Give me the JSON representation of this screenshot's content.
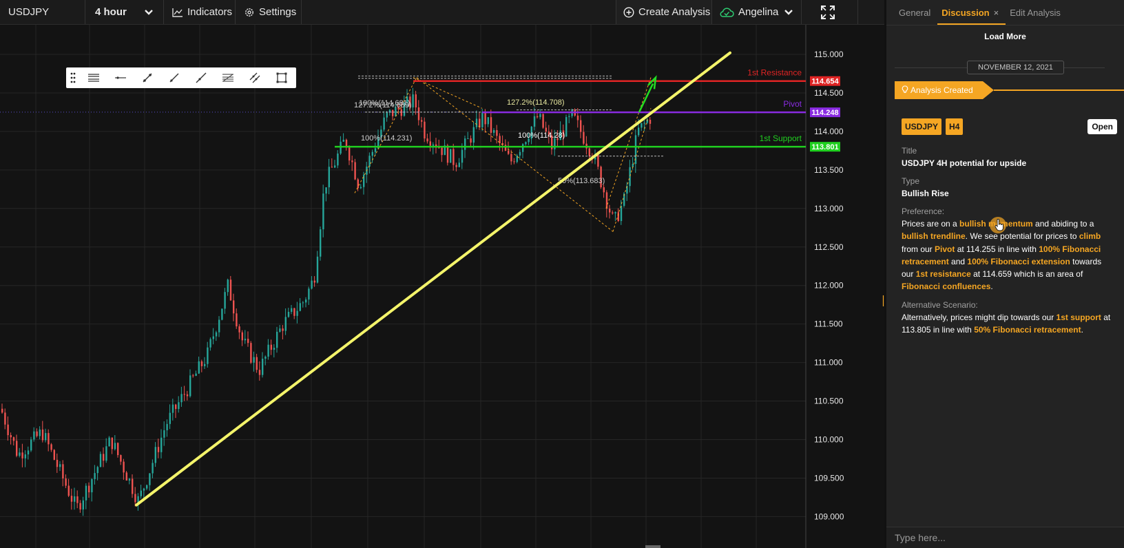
{
  "topbar": {
    "symbol": "USDJPY",
    "interval": "4 hour",
    "indicators_label": "Indicators",
    "settings_label": "Settings",
    "create_label": "Create Analysis",
    "user_name": "Angelina"
  },
  "chart_data": {
    "type": "candlestick",
    "symbol": "USDJPY",
    "y_ticks": [
      "115.000",
      "114.500",
      "114.000",
      "113.500",
      "113.000",
      "112.500",
      "112.000",
      "111.500",
      "111.000",
      "110.500",
      "110.000",
      "109.500",
      "109.000"
    ],
    "ylim": [
      108.95,
      115.55
    ],
    "levels": [
      {
        "name": "1st Resistance",
        "value": 114.654,
        "label": "114.654",
        "color": "#e02424"
      },
      {
        "name": "Pivot",
        "value": 114.248,
        "label": "114.248",
        "color": "#8a2be2"
      },
      {
        "name": "1st Support",
        "value": 113.801,
        "label": "113.801",
        "color": "#20d020"
      }
    ],
    "fib_labels": [
      "100%(114.681)",
      "127.2%(114.689)",
      "127.2%(114.708)",
      "100%(114.231)",
      "100%(114.28)",
      "50%(113.683)"
    ],
    "trendline": {
      "from": 109.15,
      "to": 115.02
    },
    "colors": {
      "up": "#26a69a",
      "down": "#ef5350",
      "trend": "#f4f46a",
      "fib": "#f5a623",
      "arrow": "#22dd22"
    }
  },
  "panel": {
    "tabs": [
      "General",
      "Discussion",
      "Edit Analysis"
    ],
    "active_tab": "Discussion",
    "load_more": "Load More",
    "date": "NOVEMBER 12, 2021",
    "created_label": "Analysis Created",
    "tags": [
      "USDJPY",
      "H4"
    ],
    "open_label": "Open",
    "title_label": "Title",
    "title_value": "USDJPY 4H potential for upside",
    "type_label": "Type",
    "type_value": "Bullish Rise",
    "preference_label": "Preference:",
    "alternative_label": "Alternative Scenario:",
    "comment_placeholder": "Type here...",
    "pref": {
      "t1": "Prices are on a ",
      "h1": "bullish momentum",
      "t2": " and abiding to a ",
      "h2": "bullish trendline",
      "t3": ". We see potential for prices to ",
      "h3": "climb",
      "t4": " from our ",
      "h4": "Pivot",
      "t5": " at 114.255 in line with ",
      "h5": "100% Fibonacci retracement",
      "t6": " and ",
      "h6": "100% Fibonacci extension",
      "t7": " towards our ",
      "h7": "1st resistance",
      "t8": " at 114.659 which is an area of ",
      "h8": "Fibonacci confluences",
      "t9": "."
    },
    "alt": {
      "t1": "Alternatively, prices might dip towards our ",
      "h1": "1st support",
      "t2": " at 113.805 in line with ",
      "h2": "50% Fibonacci retracement",
      "t3": "."
    }
  }
}
